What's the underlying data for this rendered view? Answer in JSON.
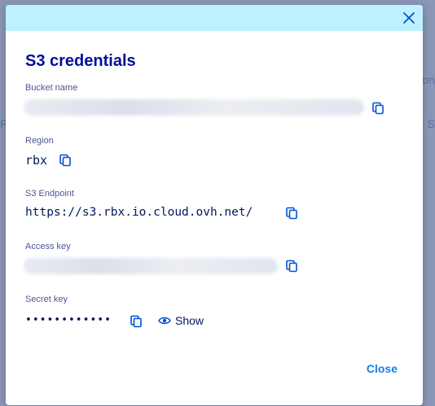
{
  "modal": {
    "title": "S3 credentials",
    "close_label": "Close",
    "fields": {
      "bucket_name": {
        "label": "Bucket name"
      },
      "region": {
        "label": "Region",
        "value": "rbx"
      },
      "s3_endpoint": {
        "label": "S3 Endpoint",
        "value": "https://s3.rbx.io.cloud.ovh.net/"
      },
      "access_key": {
        "label": "Access key"
      },
      "secret_key": {
        "label": "Secret key",
        "masked_value": "••••••••••••",
        "show_label": "Show"
      }
    }
  },
  "background": {
    "fragment_right_top": "ion",
    "fragment_left": "R",
    "fragment_right": "- S"
  },
  "colors": {
    "header_bg": "#bef1ff",
    "title": "#000e9c",
    "label": "#4d5693",
    "value": "#00185e",
    "accent": "#157eea",
    "icon": "#0050d7"
  },
  "icons": {
    "close": "close-x-icon",
    "copy": "copy-icon",
    "show": "eye-icon"
  }
}
